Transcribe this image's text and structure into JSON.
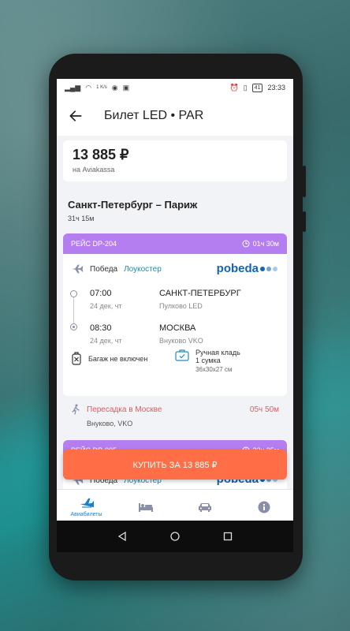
{
  "status": {
    "time": "23:33",
    "battery": "41",
    "net_speed": "1 K/s"
  },
  "appbar": {
    "title": "Билет LED • PAR"
  },
  "price": {
    "amount": "13 885 ₽",
    "source": "на Aviakassa"
  },
  "route": {
    "title": "Санкт-Петербург – Париж",
    "duration": "31ч 15м"
  },
  "leg1": {
    "flight": "РЕЙС DP-204",
    "duration": "01ч 30м",
    "carrier": "Победа",
    "carrier_type": "Лоукостер",
    "logo": "pobeda",
    "departure": {
      "time": "07:00",
      "date": "24 дек, чт",
      "city": "САНКТ-ПЕТЕРБУРГ",
      "airport": "Пулково LED"
    },
    "arrival": {
      "time": "08:30",
      "date": "24 дек, чт",
      "city": "МОСКВА",
      "airport": "Внуково VKO"
    },
    "baggage": "Багаж не включен",
    "handbag": {
      "title": "Ручная кладь",
      "count": "1 сумка",
      "size": "36x30x27 см"
    }
  },
  "transfer": {
    "label": "Пересадка в Москве",
    "duration": "05ч 50м",
    "airport": "Внуково, VKO"
  },
  "leg2": {
    "flight": "РЕЙС DP-005",
    "duration": "22ч 25м",
    "carrier": "Победа",
    "carrier_type": "Лоукостер",
    "logo": "pobeda"
  },
  "buy_button": {
    "label": "КУПИТЬ ЗА 13 885 ₽"
  },
  "bottom_nav": {
    "items": [
      {
        "label": "Авиабилеты",
        "icon": "airplane-icon"
      },
      {
        "label": "",
        "icon": "bed-icon"
      },
      {
        "label": "",
        "icon": "car-icon"
      },
      {
        "label": "",
        "icon": "info-icon"
      }
    ]
  },
  "colors": {
    "accent": "#1a7fc6",
    "leg_header": "#b57ef0",
    "buy_button": "#ff6e47",
    "transfer": "#e35a5a"
  }
}
